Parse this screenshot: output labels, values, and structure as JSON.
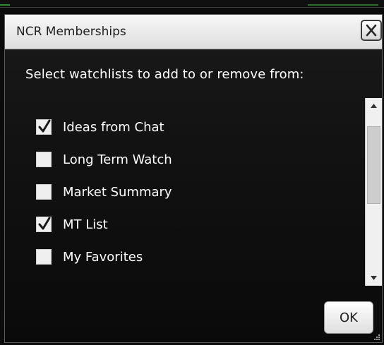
{
  "dialog": {
    "title": "NCR Memberships",
    "close_icon": "close-icon",
    "prompt": "Select watchlists to add to or remove from:",
    "ok_label": "OK"
  },
  "watchlists": [
    {
      "label": "Ideas from Chat",
      "checked": true
    },
    {
      "label": "Long Term Watch",
      "checked": false
    },
    {
      "label": "Market Summary",
      "checked": false
    },
    {
      "label": "MT List",
      "checked": true
    },
    {
      "label": "My Favorites",
      "checked": false
    }
  ],
  "scrollbar": {
    "up_icon": "arrow-up-icon",
    "down_icon": "arrow-down-icon"
  },
  "colors": {
    "dialog_bg": "#121212",
    "titlebar": "#e9e9e9",
    "text": "#ffffff",
    "checkbox": "#efefef"
  }
}
